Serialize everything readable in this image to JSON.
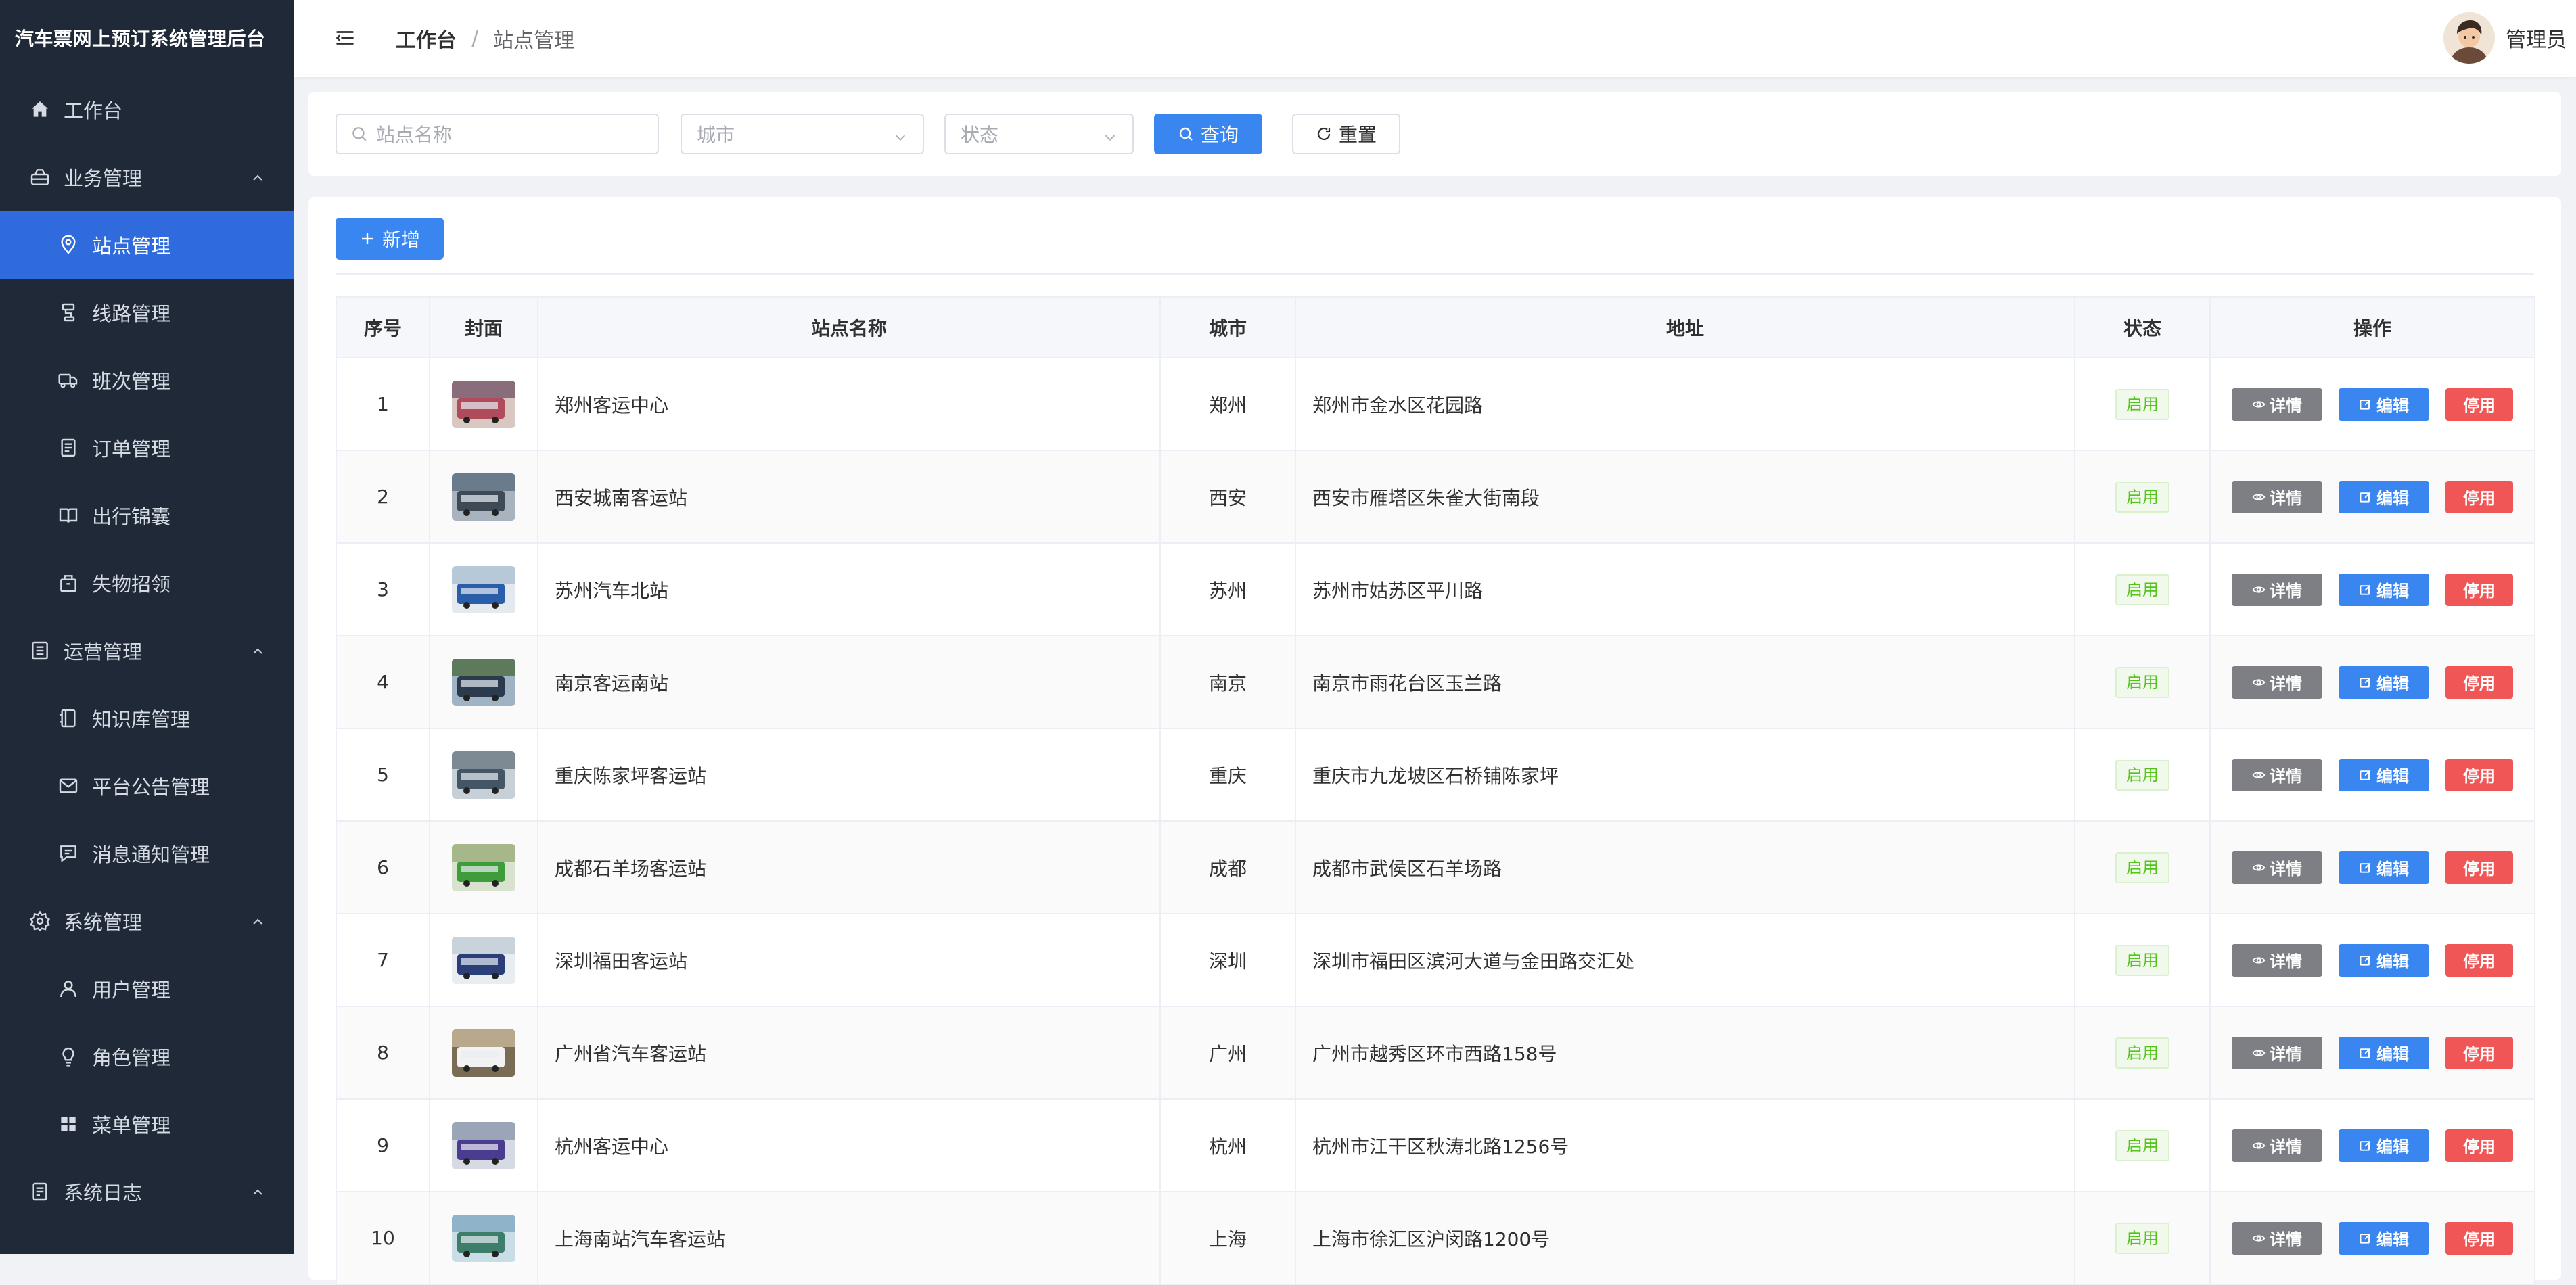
{
  "app": {
    "title": "汽车票网上预订系统管理后台"
  },
  "sidebar": {
    "items": [
      {
        "label": "工作台",
        "icon": "home-icon",
        "level": 0
      },
      {
        "label": "业务管理",
        "icon": "business-icon",
        "level": 0,
        "expanded": true
      },
      {
        "label": "站点管理",
        "icon": "location-icon",
        "level": 1,
        "active": true
      },
      {
        "label": "线路管理",
        "icon": "route-icon",
        "level": 1
      },
      {
        "label": "班次管理",
        "icon": "truck-icon",
        "level": 1
      },
      {
        "label": "订单管理",
        "icon": "document-icon",
        "level": 1
      },
      {
        "label": "出行锦囊",
        "icon": "book-icon",
        "level": 1
      },
      {
        "label": "失物招领",
        "icon": "box-icon",
        "level": 1
      },
      {
        "label": "运营管理",
        "icon": "list-icon",
        "level": 0,
        "expanded": true
      },
      {
        "label": "知识库管理",
        "icon": "notebook-icon",
        "level": 1
      },
      {
        "label": "平台公告管理",
        "icon": "message-icon",
        "level": 1
      },
      {
        "label": "消息通知管理",
        "icon": "chat-icon",
        "level": 1
      },
      {
        "label": "系统管理",
        "icon": "setting-icon",
        "level": 0,
        "expanded": true
      },
      {
        "label": "用户管理",
        "icon": "user-icon",
        "level": 1
      },
      {
        "label": "角色管理",
        "icon": "bulb-icon",
        "level": 1
      },
      {
        "label": "菜单管理",
        "icon": "grid-icon",
        "level": 1
      },
      {
        "label": "系统日志",
        "icon": "log-icon",
        "level": 0,
        "expanded": true
      }
    ]
  },
  "header": {
    "breadcrumb": {
      "home": "工作台",
      "separator": "/",
      "current": "站点管理"
    },
    "user": {
      "name": "管理员"
    }
  },
  "search": {
    "station_placeholder": "站点名称",
    "city_placeholder": "城市",
    "status_placeholder": "状态",
    "query_label": "查询",
    "reset_label": "重置"
  },
  "toolbar": {
    "add_label": "新增"
  },
  "table": {
    "columns": [
      "序号",
      "封面",
      "站点名称",
      "城市",
      "地址",
      "状态",
      "操作"
    ],
    "actions": {
      "detail": "详情",
      "edit": "编辑",
      "stop": "停用"
    },
    "rows": [
      {
        "index": "1",
        "name": "郑州客运中心",
        "city": "郑州",
        "address": "郑州市金水区花园路",
        "status": "启用"
      },
      {
        "index": "2",
        "name": "西安城南客运站",
        "city": "西安",
        "address": "西安市雁塔区朱雀大街南段",
        "status": "启用"
      },
      {
        "index": "3",
        "name": "苏州汽车北站",
        "city": "苏州",
        "address": "苏州市姑苏区平川路",
        "status": "启用"
      },
      {
        "index": "4",
        "name": "南京客运南站",
        "city": "南京",
        "address": "南京市雨花台区玉兰路",
        "status": "启用"
      },
      {
        "index": "5",
        "name": "重庆陈家坪客运站",
        "city": "重庆",
        "address": "重庆市九龙坡区石桥铺陈家坪",
        "status": "启用"
      },
      {
        "index": "6",
        "name": "成都石羊场客运站",
        "city": "成都",
        "address": "成都市武侯区石羊场路",
        "status": "启用"
      },
      {
        "index": "7",
        "name": "深圳福田客运站",
        "city": "深圳",
        "address": "深圳市福田区滨河大道与金田路交汇处",
        "status": "启用"
      },
      {
        "index": "8",
        "name": "广州省汽车客运站",
        "city": "广州",
        "address": "广州市越秀区环市西路158号",
        "status": "启用"
      },
      {
        "index": "9",
        "name": "杭州客运中心",
        "city": "杭州",
        "address": "杭州市江干区秋涛北路1256号",
        "status": "启用"
      },
      {
        "index": "10",
        "name": "上海南站汽车客运站",
        "city": "上海",
        "address": "上海市徐汇区沪闵路1200号",
        "status": "启用"
      }
    ]
  },
  "colors": {
    "sidebar_bg": "#1f2937",
    "active_bg": "#2f6bdc",
    "primary": "#3a86f0",
    "danger": "#f15656",
    "success": "#52c41a",
    "neutral": "#7d7f85"
  }
}
